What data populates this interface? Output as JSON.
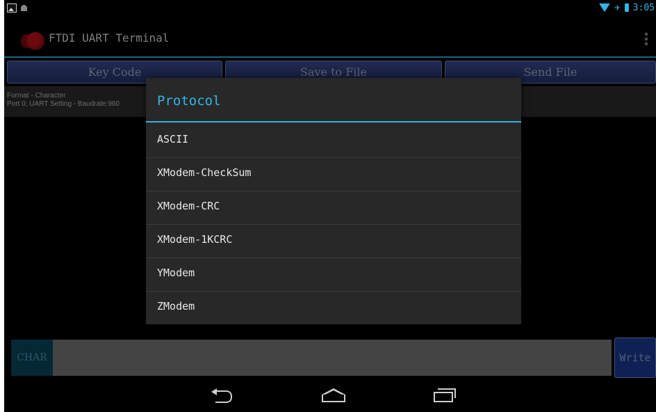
{
  "status_bar": {
    "time": "3:05",
    "left_icons": [
      "gallery-icon",
      "android-icon"
    ],
    "right_icons": [
      "wifi-icon",
      "airplane-icon",
      "battery-icon"
    ],
    "accent": "#33b5e5"
  },
  "action_bar": {
    "title": "FTDI UART Terminal",
    "icon": "app-icon",
    "overflow_icon": "overflow-icon"
  },
  "toolbar": {
    "key_code": "Key Code",
    "save_to_file": "Save to File",
    "send_file": "Send File",
    "button_color": "#2e428a"
  },
  "info": {
    "format_line": "Format - Character",
    "setting_line": "Port 0; UART Setting  -  Baudrate:960"
  },
  "input": {
    "mode_label": "CHAR",
    "value": "",
    "write_label": "Write"
  },
  "dialog": {
    "title": "Protocol",
    "items": [
      {
        "label": "ASCII"
      },
      {
        "label": "XModem-CheckSum"
      },
      {
        "label": "XModem-CRC"
      },
      {
        "label": "XModem-1KCRC"
      },
      {
        "label": "YModem"
      },
      {
        "label": "ZModem"
      }
    ]
  },
  "nav_bar": {
    "icons": [
      "back-icon",
      "home-icon",
      "recent-apps-icon"
    ]
  }
}
